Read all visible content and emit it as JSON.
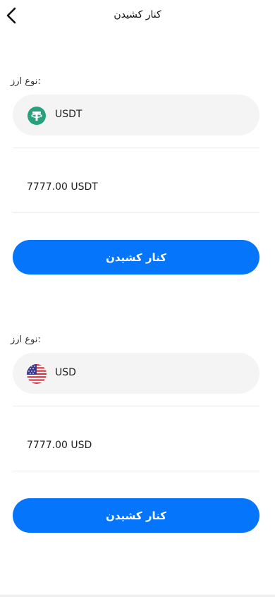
{
  "header": {
    "title": "کنار کشیدن",
    "back_icon": "chevron-left-icon"
  },
  "sections": [
    {
      "label": ":نوع ارز",
      "currency": "USDT",
      "currency_icon": "tether-icon",
      "amount": "7777.00 USDT",
      "button_label": "کنار کشیدن"
    },
    {
      "label": ":نوع ارز",
      "currency": "USD",
      "currency_icon": "us-flag-icon",
      "amount": "7777.00 USD",
      "button_label": "کنار کشیدن"
    }
  ],
  "colors": {
    "primary": "#0575fb",
    "selector_bg": "#f4f4f4",
    "tether_green": "#26a17b"
  }
}
